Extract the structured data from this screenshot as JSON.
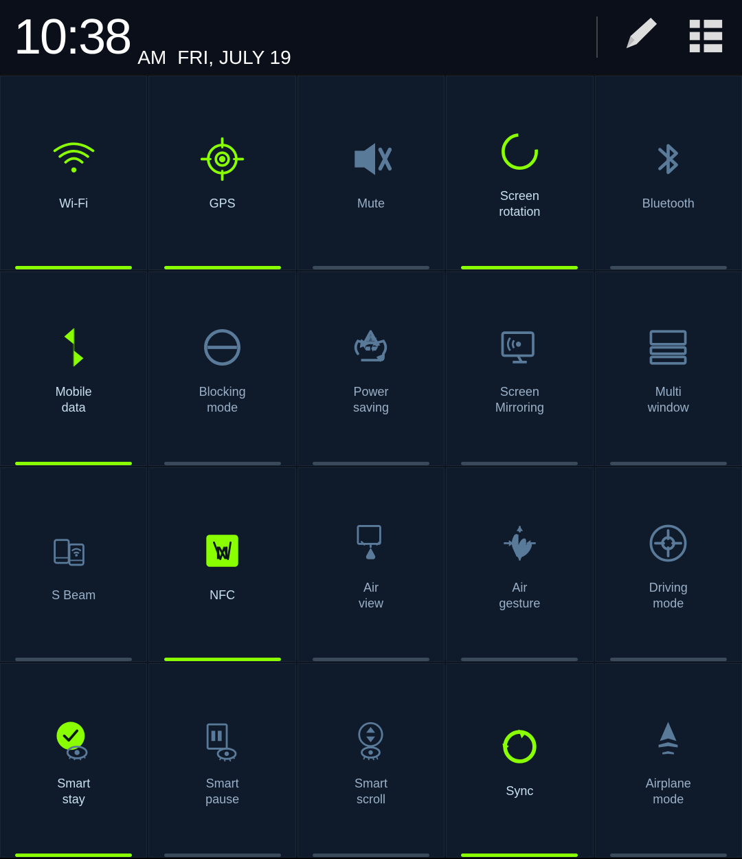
{
  "statusBar": {
    "time": "10:38",
    "ampm": "AM",
    "date": "FRI, JULY 19"
  },
  "tiles": [
    {
      "id": "wifi",
      "label": "Wi-Fi",
      "active": true,
      "row": 1,
      "col": 1
    },
    {
      "id": "gps",
      "label": "GPS",
      "active": true,
      "row": 1,
      "col": 2
    },
    {
      "id": "mute",
      "label": "Mute",
      "active": false,
      "row": 1,
      "col": 3
    },
    {
      "id": "screen-rotation",
      "label": "Screen\nrotation",
      "active": true,
      "row": 1,
      "col": 4
    },
    {
      "id": "bluetooth",
      "label": "Bluetooth",
      "active": false,
      "row": 1,
      "col": 5
    },
    {
      "id": "mobile-data",
      "label": "Mobile\ndata",
      "active": true,
      "row": 2,
      "col": 1
    },
    {
      "id": "blocking-mode",
      "label": "Blocking\nmode",
      "active": false,
      "row": 2,
      "col": 2
    },
    {
      "id": "power-saving",
      "label": "Power\nsaving",
      "active": false,
      "row": 2,
      "col": 3
    },
    {
      "id": "screen-mirroring",
      "label": "Screen\nMirroring",
      "active": false,
      "row": 2,
      "col": 4
    },
    {
      "id": "multi-window",
      "label": "Multi\nwindow",
      "active": false,
      "row": 2,
      "col": 5
    },
    {
      "id": "s-beam",
      "label": "S Beam",
      "active": false,
      "row": 3,
      "col": 1
    },
    {
      "id": "nfc",
      "label": "NFC",
      "active": true,
      "row": 3,
      "col": 2
    },
    {
      "id": "air-view",
      "label": "Air\nview",
      "active": false,
      "row": 3,
      "col": 3
    },
    {
      "id": "air-gesture",
      "label": "Air\ngesture",
      "active": false,
      "row": 3,
      "col": 4
    },
    {
      "id": "driving-mode",
      "label": "Driving\nmode",
      "active": false,
      "row": 3,
      "col": 5
    },
    {
      "id": "smart-stay",
      "label": "Smart\nstay",
      "active": true,
      "row": 4,
      "col": 1
    },
    {
      "id": "smart-pause",
      "label": "Smart\npause",
      "active": false,
      "row": 4,
      "col": 2
    },
    {
      "id": "smart-scroll",
      "label": "Smart\nscroll",
      "active": false,
      "row": 4,
      "col": 3
    },
    {
      "id": "sync",
      "label": "Sync",
      "active": true,
      "row": 4,
      "col": 4
    },
    {
      "id": "airplane-mode",
      "label": "Airplane\nmode",
      "active": false,
      "row": 4,
      "col": 5
    }
  ]
}
